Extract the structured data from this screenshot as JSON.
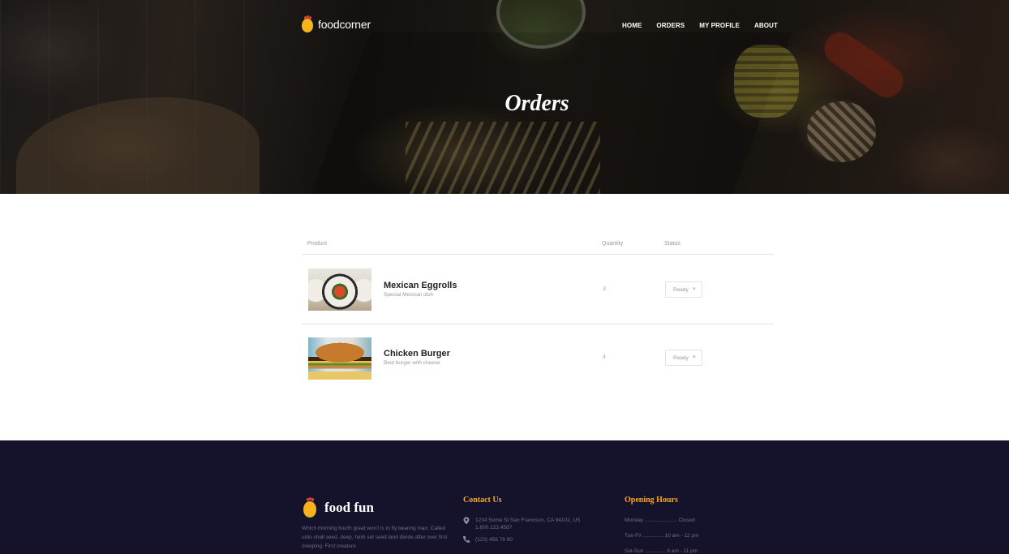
{
  "nav": {
    "brand": "foodcorner",
    "links": [
      "HOME",
      "ORDERS",
      "MY PROFILE",
      "ABOUT"
    ]
  },
  "hero": {
    "title": "Orders"
  },
  "orders": {
    "columns": {
      "product": "Product",
      "quantity": "Quantity",
      "status": "Status"
    },
    "rows": [
      {
        "name": "Mexican Eggrolls",
        "description": "Special Mexican dish",
        "quantity": "3",
        "status": "Ready",
        "image": "sushi-roll"
      },
      {
        "name": "Chicken Burger",
        "description": "Best burger with cheese",
        "quantity": "4",
        "status": "Ready",
        "image": "burger"
      }
    ]
  },
  "footer": {
    "brand": "food fun",
    "about": "Which morning fourth great won't is to fly bearing man. Called unto shall seed, deep, herb set seed land divide after over first creeping. First creature",
    "contact": {
      "heading": "Contact Us",
      "address_line1": "1234 Some St San Francisco, CA 94102, US",
      "address_line2": "1.800.123.4567",
      "phone": "(123) 456 78 90"
    },
    "hours": {
      "heading": "Opening Hours",
      "rows": [
        "Monday ...................... Closed",
        "Tue-Fri .............. 10 am - 12 pm",
        "Sat-Sun .............. 8 am - 11 pm"
      ]
    }
  },
  "colors": {
    "footer_bg": "#15132c",
    "footer_heading": "#f5a922",
    "logo_yellow": "#f6b31b",
    "logo_red": "#e1453a"
  },
  "icons": {
    "address": "map-pin-icon",
    "phone": "phone-icon",
    "status_caret": "chevron-down-icon"
  }
}
